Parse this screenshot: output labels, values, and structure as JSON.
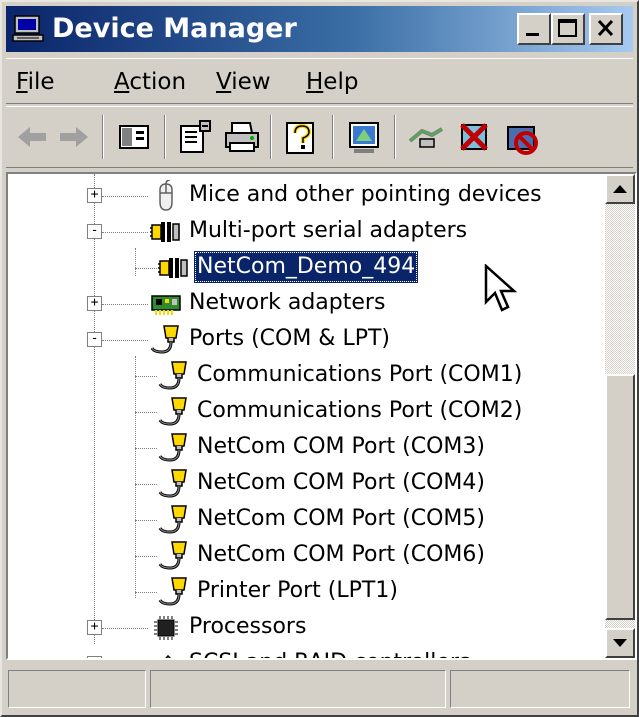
{
  "window": {
    "title": "Device Manager",
    "title_icon": "computer-icon",
    "accent": "#0a246a"
  },
  "menu": [
    {
      "mnemonic": "F",
      "rest": "ile"
    },
    {
      "mnemonic": "A",
      "rest": "ction"
    },
    {
      "mnemonic": "V",
      "rest": "iew"
    },
    {
      "mnemonic": "H",
      "rest": "elp"
    }
  ],
  "toolbar": [
    "back-arrow-icon",
    "forward-arrow-icon",
    "show-hide-tree-icon",
    "properties-icon",
    "print-icon",
    "help-icon",
    "scan-hardware-icon",
    "update-driver-icon",
    "uninstall-icon",
    "disable-icon"
  ],
  "tree": {
    "items": [
      {
        "label": "Mice and other pointing devices",
        "icon": "mouse-icon",
        "level": 1,
        "expander": "+"
      },
      {
        "label": "Multi-port serial adapters",
        "icon": "multiport-adapter-icon",
        "level": 1,
        "expander": "-"
      },
      {
        "label": "NetCom_Demo_494",
        "icon": "multiport-adapter-icon",
        "level": 2,
        "selected": true
      },
      {
        "label": "Network adapters",
        "icon": "network-card-icon",
        "level": 1,
        "expander": "+"
      },
      {
        "label": "Ports (COM & LPT)",
        "icon": "port-plug-icon",
        "level": 1,
        "expander": "-"
      },
      {
        "label": "Communications Port (COM1)",
        "icon": "port-plug-icon",
        "level": 2
      },
      {
        "label": "Communications Port (COM2)",
        "icon": "port-plug-icon",
        "level": 2
      },
      {
        "label": "NetCom COM Port (COM3)",
        "icon": "port-plug-icon",
        "level": 2
      },
      {
        "label": "NetCom COM Port (COM4)",
        "icon": "port-plug-icon",
        "level": 2
      },
      {
        "label": "NetCom COM Port (COM5)",
        "icon": "port-plug-icon",
        "level": 2
      },
      {
        "label": "NetCom COM Port (COM6)",
        "icon": "port-plug-icon",
        "level": 2
      },
      {
        "label": "Printer Port (LPT1)",
        "icon": "port-plug-icon",
        "level": 2
      },
      {
        "label": "Processors",
        "icon": "processor-icon",
        "level": 1,
        "expander": "+"
      },
      {
        "label": "SCSI and RAID controllers",
        "icon": "scsi-controller-icon",
        "level": 1,
        "expander": "+"
      }
    ]
  },
  "statusbar": {
    "panes": [
      "",
      "",
      ""
    ]
  }
}
